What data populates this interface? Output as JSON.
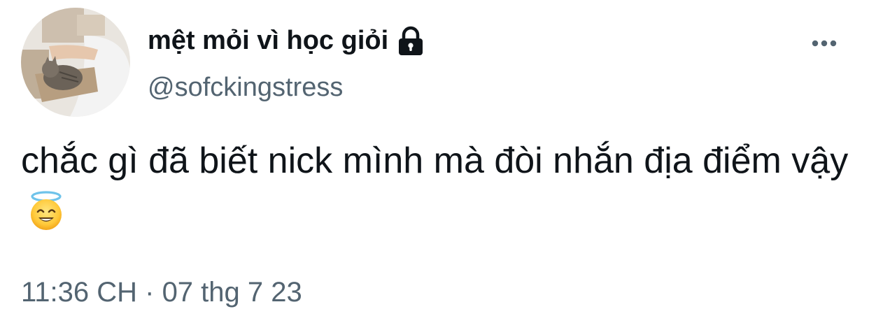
{
  "author": {
    "display_name": "mệt mỏi vì học giỏi",
    "handle": "@sofckingstress",
    "protected_icon": "lock-icon",
    "avatar": "avatar-photo-cat"
  },
  "menu": {
    "icon": "more-horizontal-icon"
  },
  "tweet": {
    "text": "chắc gì đã biết nick mình mà đòi nhắn địa điểm vậy",
    "emoji": "smiling-face-with-halo"
  },
  "meta": {
    "timestamp": "11:36 CH · 07 thg 7 23"
  },
  "colors": {
    "text_primary": "#0f1419",
    "text_secondary": "#536471",
    "background": "#ffffff"
  }
}
